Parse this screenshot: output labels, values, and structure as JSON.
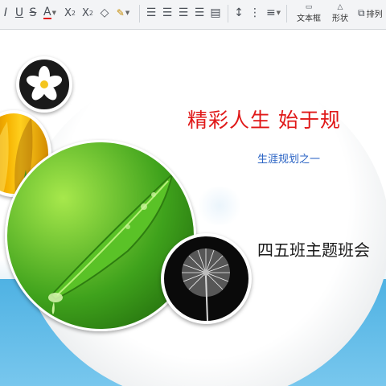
{
  "toolbar": {
    "text_box_label": "文本框",
    "shape_label": "形状",
    "arrange_label": "排列",
    "icons": [
      "italic-icon",
      "underline-icon",
      "strikethrough-icon",
      "font-color-icon",
      "superscript-icon",
      "subscript-icon",
      "clear-format-icon",
      "text-highlight-icon",
      "align-left-icon",
      "align-center-icon",
      "align-right-icon",
      "justify-icon",
      "distribute-icon",
      "line-spacing-icon",
      "bullets-icon",
      "numbering-icon",
      "textbox-icon",
      "shape-icon",
      "arrange-icon"
    ]
  },
  "slide": {
    "title": "精彩人生    始于规",
    "subtitle": "生涯规划之一",
    "class_meeting": "四五班主题班会"
  },
  "colors": {
    "title": "#e01818",
    "subtitle": "#2a63c4",
    "band": "#4fb2e3",
    "leaf": "#3fa21c"
  }
}
